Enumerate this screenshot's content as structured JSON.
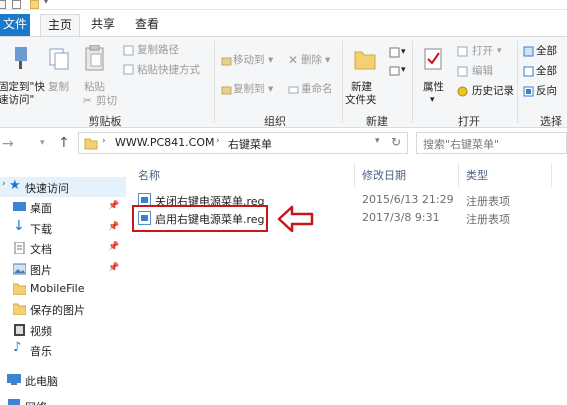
{
  "tabs": {
    "file": "文件",
    "home": "主页",
    "share": "共享",
    "view": "查看"
  },
  "ribbon": {
    "pin_label_1": "固定到\"快",
    "pin_label_2": "速访问\"",
    "copy": "复制",
    "paste": "粘贴",
    "copy_path": "复制路径",
    "paste_shortcut": "粘贴快捷方式",
    "cut": "剪切",
    "group_clipboard": "剪贴板",
    "move_to": "移动到",
    "copy_to": "复制到",
    "delete": "删除",
    "rename": "重命名",
    "group_organize": "组织",
    "new_folder_1": "新建",
    "new_folder_2": "文件夹",
    "group_new": "新建",
    "properties": "属性",
    "open": "打开",
    "edit": "编辑",
    "history": "历史记录",
    "group_open": "打开",
    "select_all": "全部",
    "select_none": "全部",
    "invert": "反向",
    "group_select": "选择"
  },
  "address": {
    "root": "WWW.PC841.COM",
    "folder": "右键菜单",
    "search_placeholder": "搜索\"右键菜单\""
  },
  "sidebar": {
    "quick_access": "快速访问",
    "items": [
      {
        "label": "桌面",
        "pinned": true,
        "icon": "desktop-icon"
      },
      {
        "label": "下载",
        "pinned": true,
        "icon": "download-icon"
      },
      {
        "label": "文档",
        "pinned": true,
        "icon": "document-icon"
      },
      {
        "label": "图片",
        "pinned": true,
        "icon": "picture-icon"
      },
      {
        "label": "MobileFile",
        "pinned": false,
        "icon": "folder-icon"
      },
      {
        "label": "保存的图片",
        "pinned": false,
        "icon": "folder-icon"
      },
      {
        "label": "视频",
        "pinned": false,
        "icon": "video-icon"
      },
      {
        "label": "音乐",
        "pinned": false,
        "icon": "music-icon"
      }
    ],
    "this_pc": "此电脑",
    "network": "网络"
  },
  "columns": {
    "name": "名称",
    "date": "修改日期",
    "type": "类型"
  },
  "files": [
    {
      "name": "关闭右键电源菜单.reg",
      "date": "2015/6/13 21:29",
      "type": "注册表项"
    },
    {
      "name": "启用右键电源菜单.reg",
      "date": "2017/3/8 9:31",
      "type": "注册表项"
    }
  ],
  "colors": {
    "accent": "#1979ca",
    "highlight": "#c8161d"
  }
}
